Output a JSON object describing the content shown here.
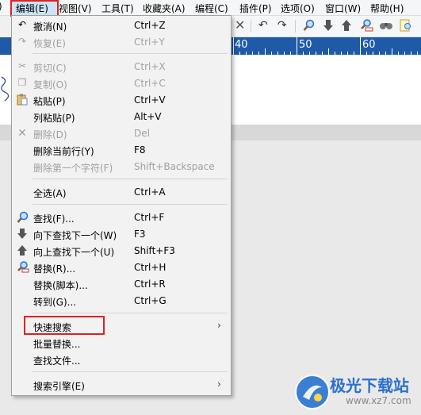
{
  "menubar": {
    "items": [
      {
        "label": "编辑(E)"
      },
      {
        "label": "视图(V)"
      },
      {
        "label": "工具(T)"
      },
      {
        "label": "收藏夹(A)"
      },
      {
        "label": "编程(C)"
      },
      {
        "label": "插件(P)"
      },
      {
        "label": "选项(O)"
      },
      {
        "label": "窗口(W)"
      },
      {
        "label": "帮助(H)"
      }
    ]
  },
  "ruler": {
    "marks": [
      "40",
      "50",
      "60"
    ]
  },
  "edit_menu": {
    "items": [
      {
        "label": "撤消(N)",
        "shortcut": "Ctrl+Z",
        "icon": "undo-icon"
      },
      {
        "label": "恢复(E)",
        "shortcut": "Ctrl+Y",
        "icon": "redo-icon",
        "disabled": true
      },
      {
        "label": "剪切(C)",
        "shortcut": "Ctrl+X",
        "icon": "scissors-icon",
        "disabled": true
      },
      {
        "label": "复制(O)",
        "shortcut": "Ctrl+C",
        "icon": "copy-icon",
        "disabled": true
      },
      {
        "label": "粘贴(P)",
        "shortcut": "Ctrl+V",
        "icon": "paste-icon"
      },
      {
        "label": "列粘贴(P)",
        "shortcut": "Alt+V"
      },
      {
        "label": "删除(D)",
        "shortcut": "Del",
        "icon": "delete-x-icon",
        "disabled": true
      },
      {
        "label": "删除当前行(Y)",
        "shortcut": "F8"
      },
      {
        "label": "删除第一个字符(F)",
        "shortcut": "Shift+Backspace",
        "disabled": true
      },
      {
        "label": "全选(A)",
        "shortcut": "Ctrl+A"
      },
      {
        "label": "查找(F)...",
        "shortcut": "Ctrl+F",
        "icon": "magnifier-icon"
      },
      {
        "label": "向下查找下一个(W)",
        "shortcut": "F3",
        "icon": "arrow-down-icon"
      },
      {
        "label": "向上查找下一个(U)",
        "shortcut": "Shift+F3",
        "icon": "arrow-up-icon"
      },
      {
        "label": "替换(R)...",
        "shortcut": "Ctrl+H",
        "icon": "replace-icon"
      },
      {
        "label": "替换(脚本)...",
        "shortcut": "Ctrl+R"
      },
      {
        "label": "转到(G)...",
        "shortcut": "Ctrl+G"
      },
      {
        "label": "快速搜索",
        "submenu": true
      },
      {
        "label": "批量替换..."
      },
      {
        "label": "查找文件..."
      },
      {
        "label": "搜索引擎(E)",
        "submenu": true
      }
    ]
  },
  "watermark": {
    "title": "极光下载站",
    "url": "www.xz7.com"
  },
  "colors": {
    "ruler": "#1e5aa7",
    "highlight": "#cce4f7",
    "annotation_box": "#e02020"
  }
}
